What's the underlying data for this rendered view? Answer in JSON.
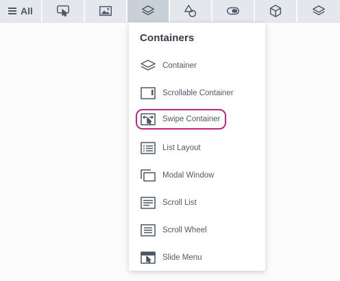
{
  "toolbar": {
    "all_label": "All",
    "tabs": [
      {
        "icon": "hamburger-icon"
      },
      {
        "icon": "touch-cursor-icon"
      },
      {
        "icon": "image-icon"
      },
      {
        "icon": "layers-icon",
        "active": true
      },
      {
        "icon": "shapes-icon"
      },
      {
        "icon": "toggle-icon"
      },
      {
        "icon": "cube-icon"
      },
      {
        "icon": "stack-icon"
      }
    ]
  },
  "dropdown": {
    "title": "Containers",
    "items": [
      {
        "label": "Container",
        "icon": "layers-icon"
      },
      {
        "label": "Scrollable Container",
        "icon": "scrollable-container-icon"
      },
      {
        "label": "Swipe Container",
        "icon": "swipe-container-icon",
        "highlighted": true
      },
      {
        "label": "List Layout",
        "icon": "list-layout-icon"
      },
      {
        "label": "Modal Window",
        "icon": "modal-window-icon"
      },
      {
        "label": "Scroll List",
        "icon": "scroll-list-icon"
      },
      {
        "label": "Scroll Wheel",
        "icon": "scroll-wheel-icon"
      },
      {
        "label": "Slide Menu",
        "icon": "slide-menu-icon"
      }
    ]
  },
  "colors": {
    "accent_highlight": "#c2227f",
    "toolbar_bg": "#e4e8ed",
    "active_tab_bg": "#c9d0d8",
    "icon_color": "#4a5664"
  }
}
